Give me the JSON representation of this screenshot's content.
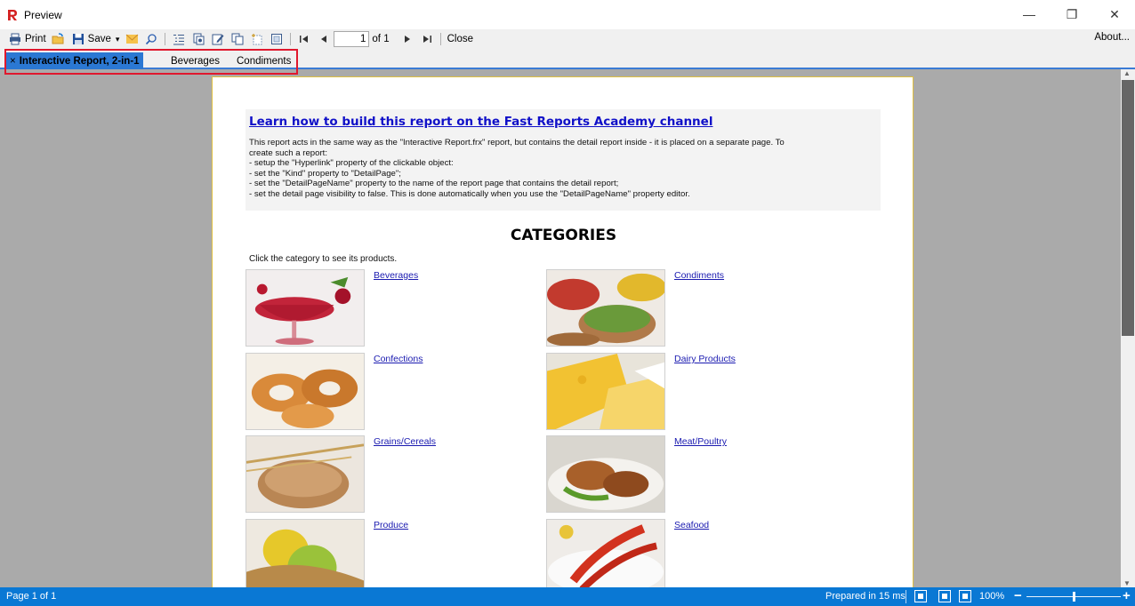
{
  "window": {
    "title": "Preview",
    "controls": {
      "minimize": "—",
      "restore": "❐",
      "close": "✕"
    }
  },
  "toolbar": {
    "print_label": "Print",
    "save_label": "Save",
    "save_dropdown": "▾",
    "page_value": "1",
    "page_of": "of 1",
    "close_label": "Close",
    "about_label": "About...",
    "icons": [
      "print-icon",
      "open-icon",
      "save-icon",
      "email-icon",
      "find-icon",
      "outline-icon",
      "page-setup-icon",
      "edit-page-icon",
      "copy-page-icon",
      "new-page-icon",
      "delete-page-icon",
      "first-page-icon",
      "prev-page-icon",
      "next-page-icon",
      "last-page-icon"
    ]
  },
  "tabs": [
    {
      "label": "Interactive Report, 2-in-1",
      "active": true,
      "close": "×"
    },
    {
      "label": "Beverages",
      "active": false
    },
    {
      "label": "Condiments",
      "active": false
    }
  ],
  "report": {
    "link_text": "Learn how to build this report on the Fast Reports Academy channel",
    "info_lines": [
      "This report acts in the same way as the \"Interactive Report.frx\" report, but contains the detail report inside - it is placed on a separate page. To",
      "create such a report:",
      "- setup the \"Hyperlink\" property of the clickable object:",
      "- set the \"Kind\" property to \"DetailPage\";",
      "- set the \"DetailPageName\" property to the name of the report page that contains the detail report;",
      "- set the detail page visibility to false. This is done automatically when you use the \"DetailPageName\" property editor."
    ],
    "title": "CATEGORIES",
    "hint": "Click the category to see its products.",
    "categories": [
      {
        "name": "Beverages",
        "image": "beverages-photo"
      },
      {
        "name": "Condiments",
        "image": "condiments-photo"
      },
      {
        "name": "Confections",
        "image": "confections-photo"
      },
      {
        "name": "Dairy Products",
        "image": "dairy-photo"
      },
      {
        "name": "Grains/Cereals",
        "image": "grains-photo"
      },
      {
        "name": "Meat/Poultry",
        "image": "meat-photo"
      },
      {
        "name": "Produce",
        "image": "produce-photo"
      },
      {
        "name": "Seafood",
        "image": "seafood-photo"
      }
    ]
  },
  "status": {
    "page_text": "Page 1 of 1",
    "prepared_text": "Prepared in 15 ms",
    "zoom_text": "100%",
    "zoom_minus": "−",
    "zoom_plus": "+"
  },
  "colors": {
    "accent": "#0a78d4",
    "active_tab": "#2b78d3",
    "highlight_box": "#e0182d",
    "link": "#1010c8",
    "workspace": "#aaaaaa"
  }
}
